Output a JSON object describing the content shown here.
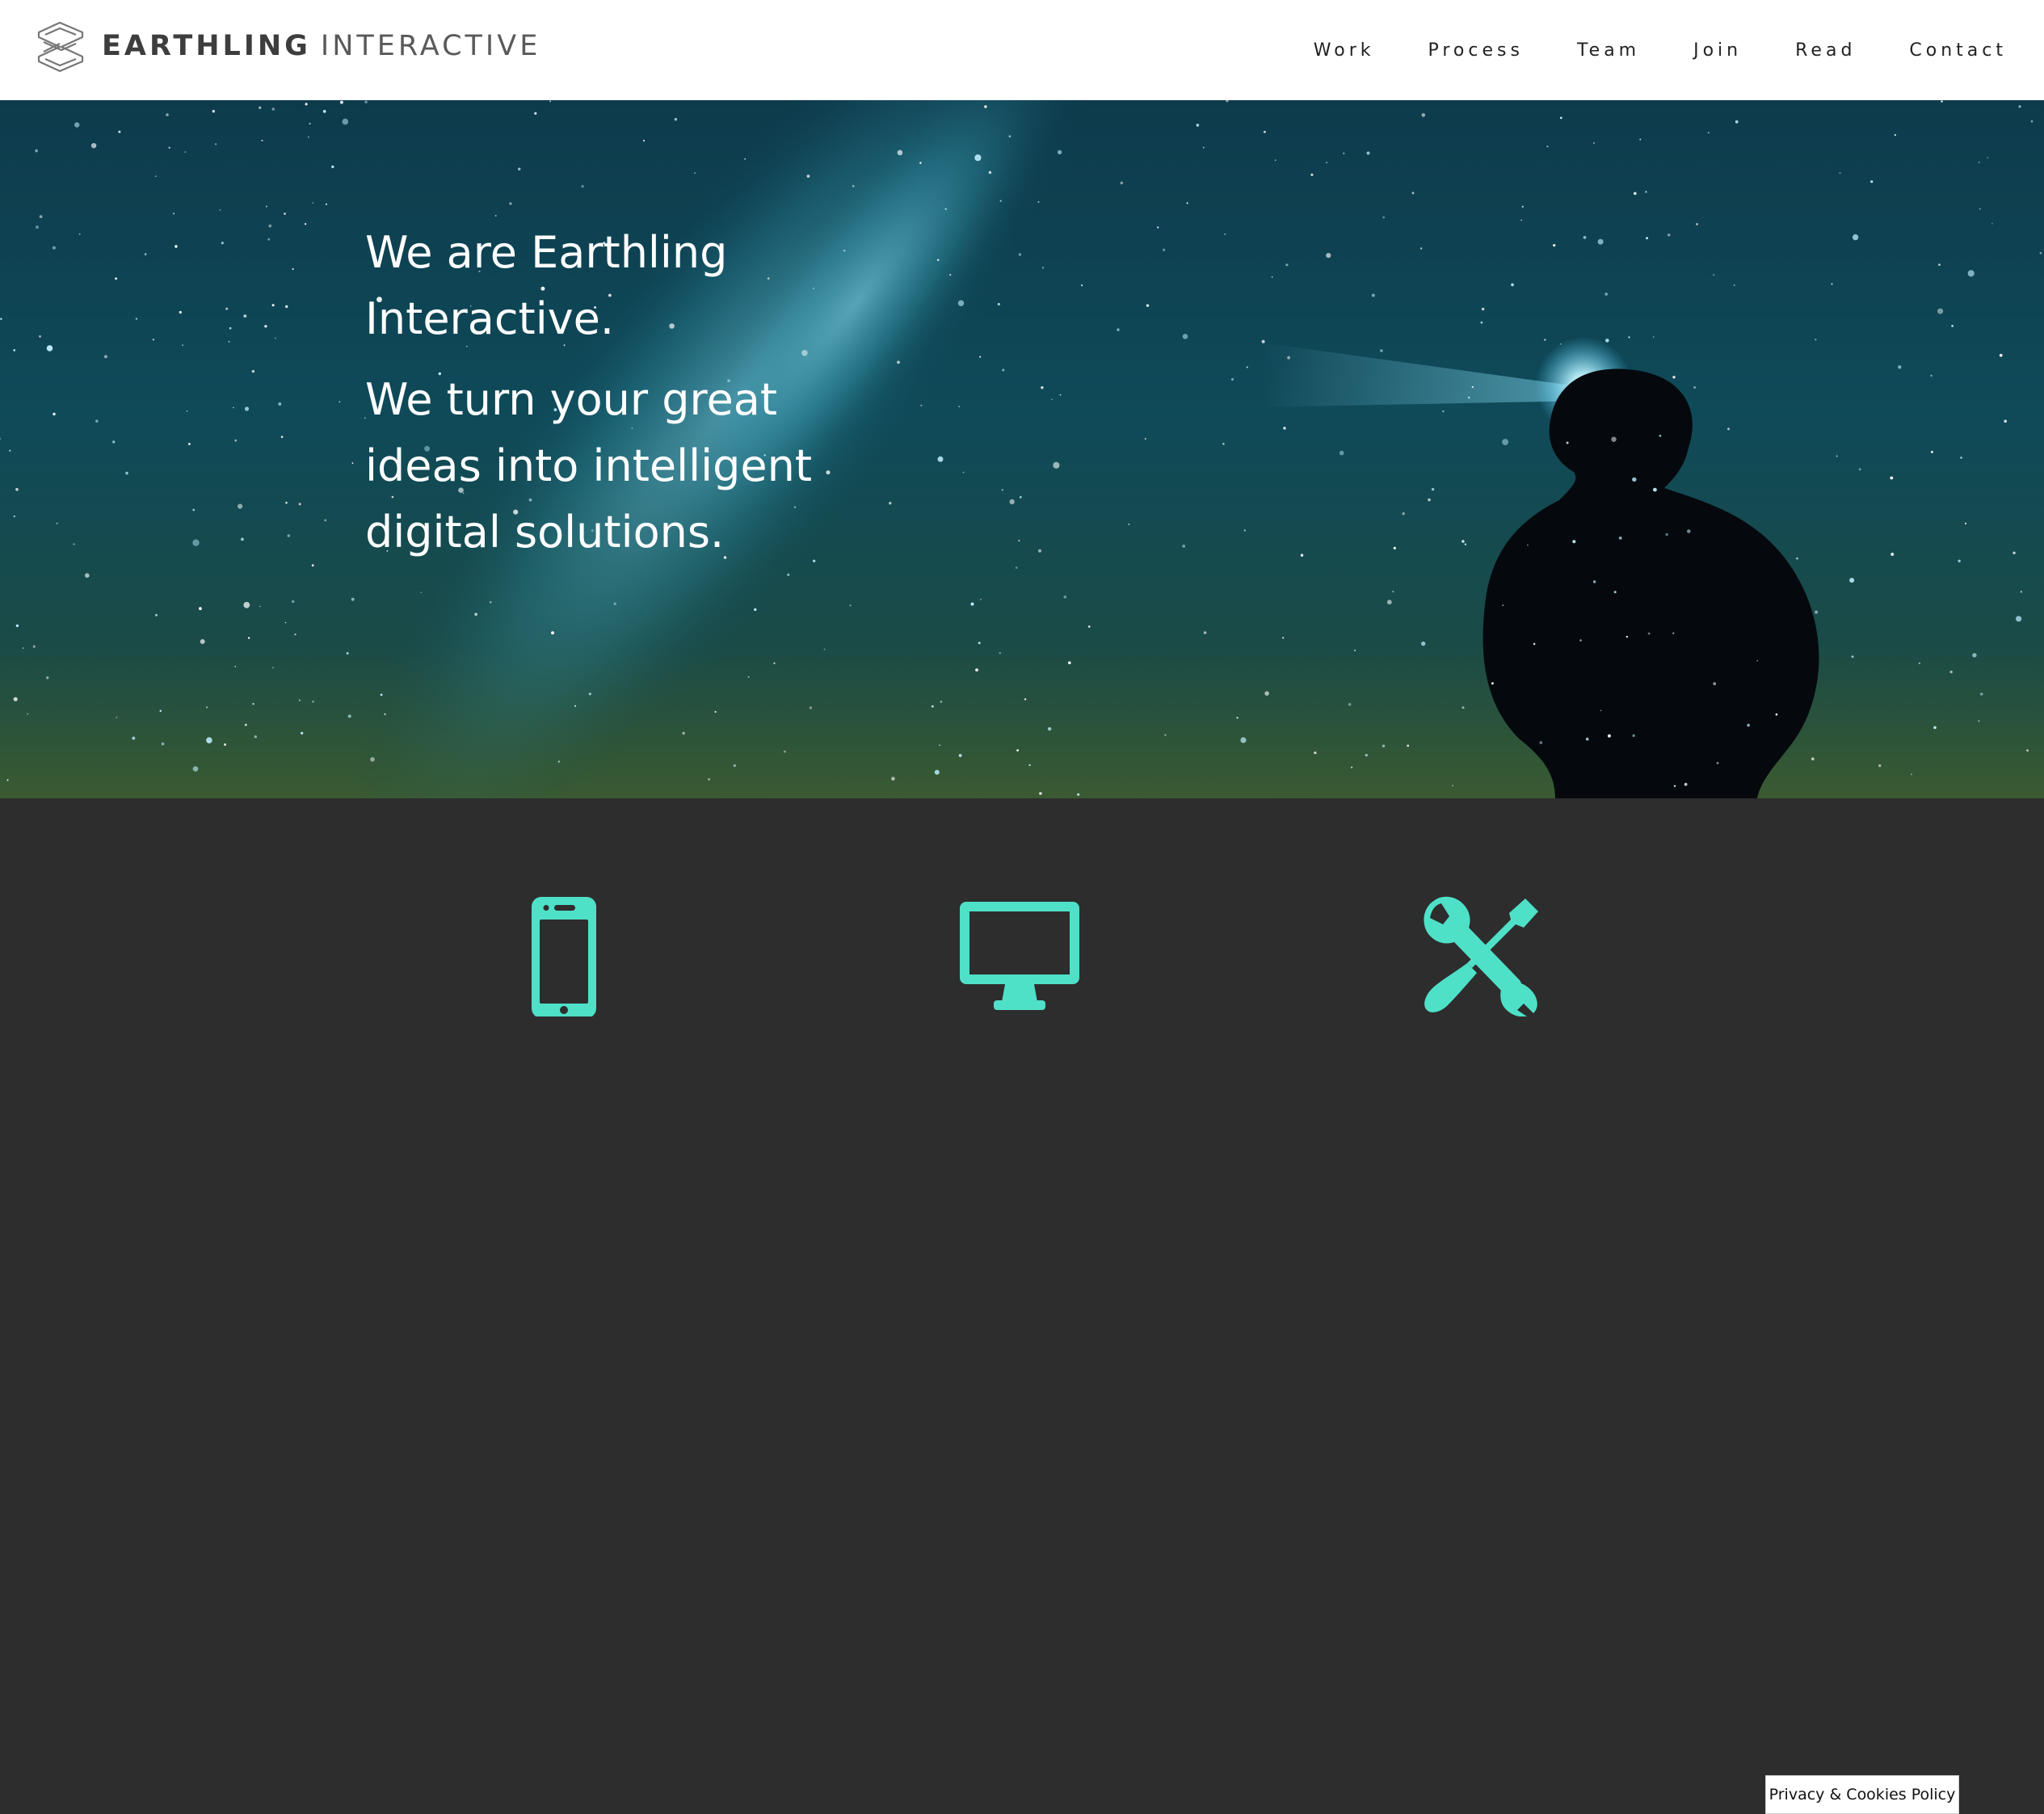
{
  "brand": {
    "name_bold": "EARTHLING",
    "name_light": "INTERACTIVE",
    "logo_icon": "earthling-logo-mark"
  },
  "nav": {
    "items": [
      {
        "label": "Work"
      },
      {
        "label": "Process"
      },
      {
        "label": "Team"
      },
      {
        "label": "Join"
      },
      {
        "label": "Read"
      },
      {
        "label": "Contact"
      }
    ]
  },
  "hero": {
    "headline": "We are Earthling Interactive.",
    "tagline": "We turn your great ideas into intelligent digital solutions.",
    "background": "night-sky-milky-way-person-with-headlamp"
  },
  "services": {
    "icons": [
      {
        "icon": "mobile-phone-icon"
      },
      {
        "icon": "desktop-monitor-icon"
      },
      {
        "icon": "wrench-screwdriver-tools-icon"
      }
    ],
    "accent_color": "#4fe0c8"
  },
  "cookie_policy": {
    "label": "Privacy & Cookies Policy"
  },
  "colors": {
    "header_bg": "#ffffff",
    "services_bg": "#2d2d2d",
    "accent": "#4fe0c8"
  }
}
